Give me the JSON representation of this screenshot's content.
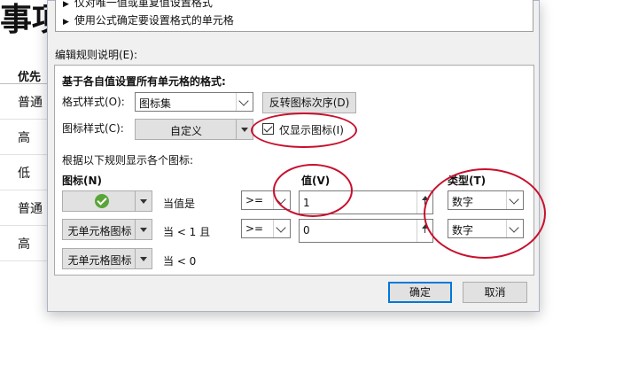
{
  "background": {
    "title_fragment": "事项",
    "header": "优先",
    "rows": [
      "普通",
      "高",
      "低",
      "普通",
      "高"
    ]
  },
  "rule_list": {
    "items": [
      "仅对唯一值或重复值设置格式",
      "使用公式确定要设置格式的单元格"
    ]
  },
  "rule_desc": {
    "label": "编辑规则说明(E):",
    "heading": "基于各自值设置所有单元格的格式:",
    "format_style_label": "格式样式(O):",
    "format_style_value": "图标集",
    "reverse_button": "反转图标次序(D)",
    "icon_style_label": "图标样式(C):",
    "icon_style_value": "自定义",
    "show_icon_only_label": "仅显示图标(I)",
    "show_icon_only_checked": true,
    "rules_caption": "根据以下规则显示各个图标:",
    "col_icon": "图标(N)",
    "col_value": "值(V)",
    "col_type": "类型(T)",
    "rows": [
      {
        "icon": "green-check",
        "icon_text": "",
        "condition": "当值是",
        "operator": ">=",
        "value": "1",
        "type": "数字"
      },
      {
        "icon": "none",
        "icon_text": "无单元格图标",
        "condition": "当 < 1 且",
        "operator": ">=",
        "value": "0",
        "type": "数字"
      },
      {
        "icon": "none",
        "icon_text": "无单元格图标",
        "condition": "当 < 0"
      }
    ]
  },
  "buttons": {
    "ok": "确定",
    "cancel": "取消"
  },
  "colors": {
    "highlight_ellipse": "#c8102e",
    "accent": "#0078d7",
    "check_icon": "#5aa53a"
  }
}
